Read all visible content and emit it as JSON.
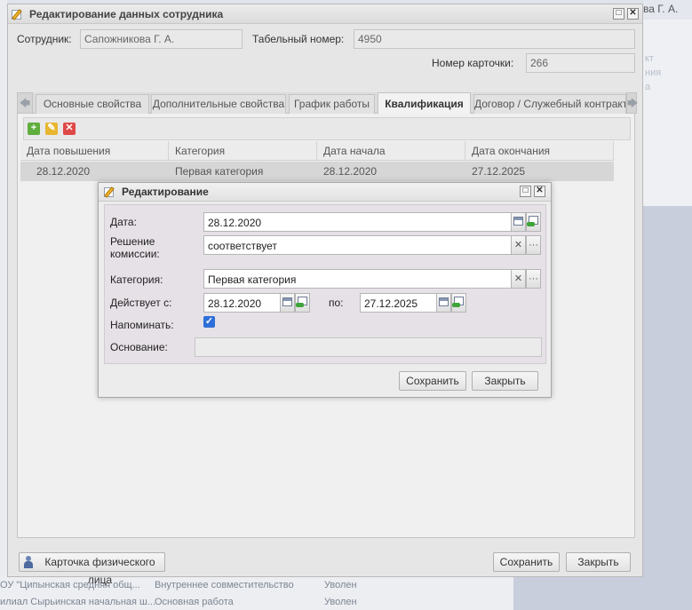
{
  "background": {
    "right_top_text": "ва Г. А.",
    "right_panel_text": [
      "кт",
      "ния",
      "а"
    ],
    "rows": [
      {
        "org": "ОУ \"Ципынская средняя общ...",
        "type": "Внутреннее совместительство",
        "status": "Уволен"
      },
      {
        "org": "илиал Сырьинская начальная ш...",
        "type": "Основная работа",
        "status": "Уволен"
      }
    ]
  },
  "window": {
    "title": "Редактирование данных сотрудника",
    "employee_label": "Сотрудник:",
    "employee_value": "Сапожникова Г. А.",
    "tabnum_label": "Табельный номер:",
    "tabnum_value": "4950",
    "card_label": "Номер карточки:",
    "card_value": "266",
    "tabs": [
      "Основные свойства",
      "Дополнительные свойства",
      "График работы",
      "Квалификация",
      "Договор / Служебный контракт"
    ],
    "grid": {
      "columns": [
        "Дата повышения",
        "Категория",
        "Дата начала",
        "Дата окончания"
      ],
      "rows": [
        [
          "28.12.2020",
          "Первая категория",
          "28.12.2020",
          "27.12.2025"
        ]
      ]
    },
    "person_card_button": "Карточка физического лица",
    "save_button": "Сохранить",
    "close_button": "Закрыть"
  },
  "dialog": {
    "title": "Редактирование",
    "date_label": "Дата:",
    "date_value": "28.12.2020",
    "decision_label_1": "Решение",
    "decision_label_2": "комиссии:",
    "decision_value": "соответствует",
    "category_label": "Категория:",
    "category_value": "Первая категория",
    "valid_from_label": "Действует с:",
    "valid_from_value": "28.12.2020",
    "valid_to_label": "по:",
    "valid_to_value": "27.12.2025",
    "remind_label": "Напоминать:",
    "remind_checked": true,
    "basis_label": "Основание:",
    "basis_value": "",
    "save_button": "Сохранить",
    "close_button": "Закрыть"
  },
  "glyphs": {
    "check": "✓",
    "clear": "✕",
    "ellipsis": "···",
    "add": "+",
    "delete": "✕",
    "arrow_left": "🡄",
    "arrow_right": "🡆"
  },
  "colors": {
    "add_green": "#5fae3e",
    "edit_yellow": "#e9b632",
    "delete_red": "#e04848",
    "checkbox_blue": "#2f6fd9"
  }
}
